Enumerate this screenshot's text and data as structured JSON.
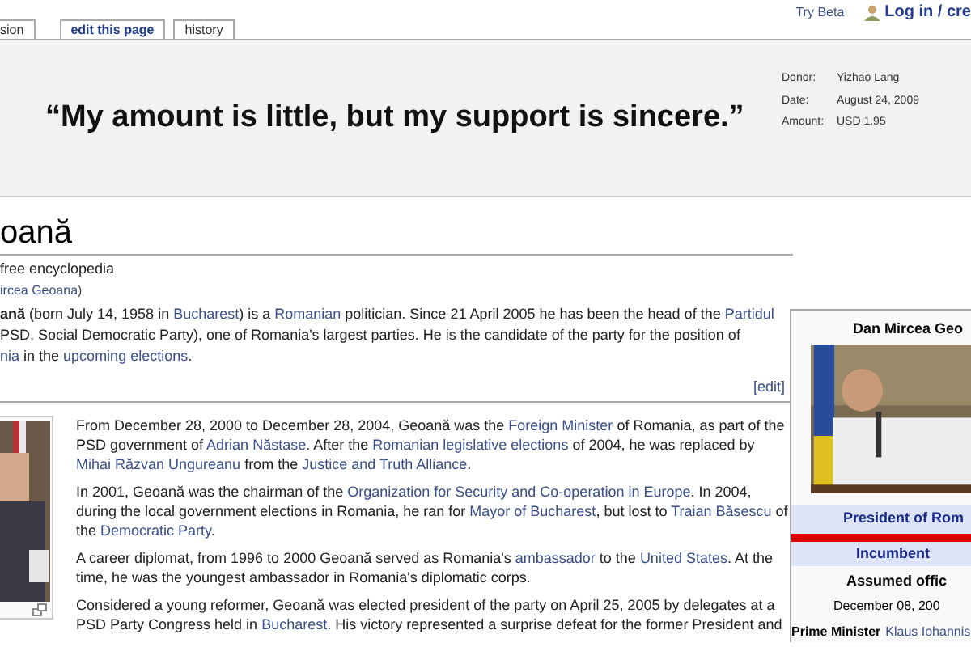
{
  "tabs": [
    {
      "label": "sion",
      "selected": false
    },
    {
      "label": "edit this page",
      "selected": true
    },
    {
      "label": "history",
      "selected": false
    }
  ],
  "personal": {
    "try_beta": "Try Beta",
    "login": "Log in / cre"
  },
  "banner": {
    "quote": "“My amount is little, but my support is sincere.”",
    "details": [
      {
        "label": "Donor:",
        "value": "Yizhao Lang"
      },
      {
        "label": "Date:",
        "value": "August 24, 2009"
      },
      {
        "label": "Amount:",
        "value": "USD 1.95"
      }
    ]
  },
  "article": {
    "title": "oană",
    "tagline": "free encyclopedia",
    "redirect": "ircea Geoana",
    "redirect_close": ")",
    "intro": [
      [
        {
          "text": "**ană** (born July 14, 1958 in "
        },
        {
          "text": "Bucharest",
          "link": true
        },
        {
          "text": ") is a "
        },
        {
          "text": "Romanian",
          "link": true
        },
        {
          "text": " politician. Since 21 April 2005 he has been the head of the "
        },
        {
          "text": "Partidul",
          "link": true
        }
      ],
      [
        {
          "text": "PSD, Social Democratic Party), one of Romania's largest parties. He is the candidate of the party for the position of"
        }
      ],
      [
        {
          "text": "nia",
          "link": true
        },
        {
          "text": " in the "
        },
        {
          "text": "upcoming elections",
          "link": true
        },
        {
          "text": "."
        }
      ]
    ],
    "edit_link": "[edit]",
    "paragraphs": [
      [
        [
          {
            "text": "From December 28, 2000 to December 28, 2004, Geoană was the "
          },
          {
            "text": "Foreign Minister",
            "link": true
          },
          {
            "text": " of Romania, as part of the"
          }
        ],
        [
          {
            "text": "PSD government of "
          },
          {
            "text": "Adrian Năstase",
            "link": true
          },
          {
            "text": ". After the "
          },
          {
            "text": "Romanian legislative elections",
            "link": true
          },
          {
            "text": " of 2004, he was replaced by"
          }
        ],
        [
          {
            "text": "Mihai Răzvan Ungureanu",
            "link": true
          },
          {
            "text": " from the "
          },
          {
            "text": "Justice and Truth Alliance",
            "link": true
          },
          {
            "text": "."
          }
        ]
      ],
      [
        [
          {
            "text": "In 2001, Geoană was the chairman of the "
          },
          {
            "text": "Organization for Security and Co-operation in Europe",
            "link": true
          },
          {
            "text": ". In 2004,"
          }
        ],
        [
          {
            "text": "during the local government elections in Romania, he ran for "
          },
          {
            "text": "Mayor of Bucharest",
            "link": true
          },
          {
            "text": ", but lost to "
          },
          {
            "text": "Traian Băsescu",
            "link": true
          },
          {
            "text": " of"
          }
        ],
        [
          {
            "text": "the "
          },
          {
            "text": "Democratic Party",
            "link": true
          },
          {
            "text": "."
          }
        ]
      ],
      [
        [
          {
            "text": "A career diplomat, from 1996 to 2000 Geoană served as Romania's "
          },
          {
            "text": "ambassador",
            "link": true
          },
          {
            "text": " to the "
          },
          {
            "text": "United States",
            "link": true
          },
          {
            "text": ". At the"
          }
        ],
        [
          {
            "text": "time, he was the youngest ambassador in Romania's diplomatic corps."
          }
        ]
      ],
      [
        [
          {
            "text": "Considered a young reformer, Geoană was elected president of the party on April 25, 2005 by delegates at a"
          }
        ],
        [
          {
            "text": "PSD Party Congress held in "
          },
          {
            "text": "Bucharest",
            "link": true
          },
          {
            "text": ". His victory represented a surprise defeat for the former President and"
          }
        ]
      ]
    ]
  },
  "infobox": {
    "title": "Dan Mircea Geo",
    "office": "President of Rom",
    "status": "Incumbent",
    "assumed_label": "Assumed offic",
    "assumed_date": "December 08, 200",
    "rows": [
      {
        "label": "Prime Minister",
        "value": "Klaus Iohannis"
      }
    ]
  }
}
